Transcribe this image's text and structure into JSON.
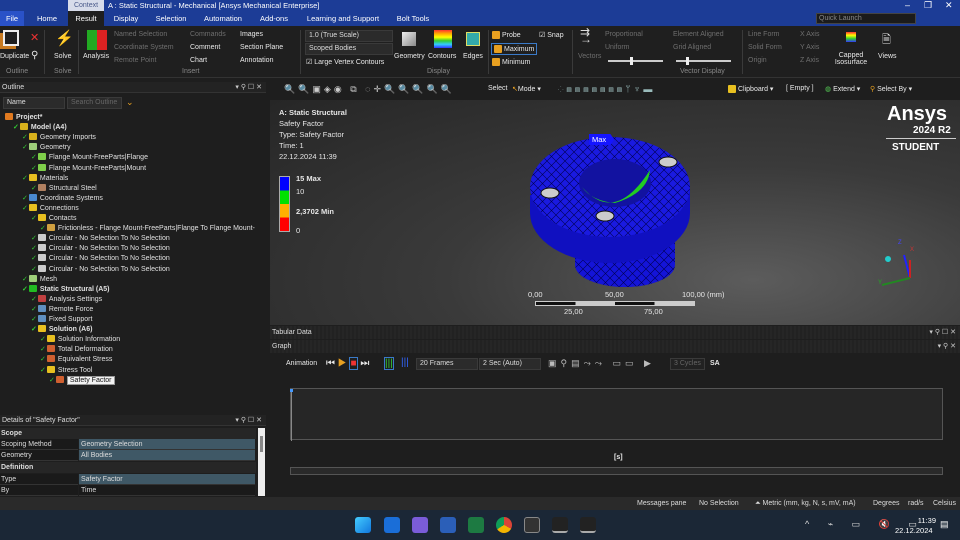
{
  "window": {
    "context_tab": "Context",
    "title": "A : Static Structural - Mechanical [Ansys Mechanical Enterprise]",
    "quick_launch_placeholder": "Quick Launch"
  },
  "menu": [
    "File",
    "Home",
    "Result",
    "Display",
    "Selection",
    "Automation",
    "Add-ons",
    "Learning and Support",
    "Bolt Tools"
  ],
  "ribbon": {
    "duplicate": "Duplicate",
    "outline_group": "Outline",
    "solve": "Solve",
    "solve_group": "Solve",
    "analysis": "Analysis",
    "named_selection": "Named Selection",
    "coordinate_system": "Coordinate System",
    "remote_point": "Remote Point",
    "commands": "Commands",
    "comment": "Comment",
    "chart": "Chart",
    "images": "Images",
    "section_plane": "Section Plane",
    "annotation": "Annotation",
    "insert_group": "Insert",
    "scale": "1.0 (True Scale)",
    "scope": "Scoped Bodies",
    "large_vertex": "Large Vertex Contours",
    "geometry": "Geometry",
    "contours": "Contours",
    "edges": "Edges",
    "display_group": "Display",
    "probe": "Probe",
    "maximum": "Maximum",
    "minimum": "Minimum",
    "snap": "Snap",
    "vectors": "Vectors",
    "proportional": "Proportional",
    "uniform": "Uniform",
    "element_aligned": "Element Aligned",
    "grid_aligned": "Grid Aligned",
    "vector_display_group": "Vector Display",
    "line_form": "Line Form",
    "solid_form": "Solid Form",
    "origin": "Origin",
    "x_axis": "X Axis",
    "y_axis": "Y Axis",
    "z_axis": "Z Axis",
    "capped_isosurface": "Capped Isosurface",
    "views": "Views"
  },
  "viewtoolbar": {
    "select": "Select",
    "mode": "Mode",
    "clipboard": "Clipboard",
    "empty": "[ Empty ]",
    "extend": "Extend",
    "select_by": "Select By"
  },
  "outline": {
    "title": "Outline",
    "filter": "Name",
    "search_placeholder": "Search Outline",
    "items": [
      {
        "label": "Project*",
        "level": 0,
        "bold": true,
        "color": "#e07a20"
      },
      {
        "label": "Model (A4)",
        "level": 1,
        "bold": true,
        "color": "#d9b21c"
      },
      {
        "label": "Geometry Imports",
        "level": 2,
        "color": "#d9b21c"
      },
      {
        "label": "Geometry",
        "level": 2,
        "color": "#9fcf7a"
      },
      {
        "label": "Flange Mount-FreeParts|Flange",
        "level": 3,
        "color": "#7fcf4a"
      },
      {
        "label": "Flange Mount-FreeParts|Mount",
        "level": 3,
        "color": "#7fcf4a"
      },
      {
        "label": "Materials",
        "level": 2,
        "color": "#e8c020"
      },
      {
        "label": "Structural Steel",
        "level": 3,
        "color": "#b08060"
      },
      {
        "label": "Coordinate Systems",
        "level": 2,
        "color": "#4a8ad0"
      },
      {
        "label": "Connections",
        "level": 2,
        "color": "#e8c020"
      },
      {
        "label": "Contacts",
        "level": 3,
        "color": "#e8c020"
      },
      {
        "label": "Frictionless - Flange Mount-FreeParts|Flange To Flange Mount-",
        "level": 4,
        "color": "#d0a040"
      },
      {
        "label": "Circular - No Selection To No Selection",
        "level": 3,
        "color": "#cccccc"
      },
      {
        "label": "Circular - No Selection To No Selection",
        "level": 3,
        "color": "#cccccc"
      },
      {
        "label": "Circular - No Selection To No Selection",
        "level": 3,
        "color": "#cccccc"
      },
      {
        "label": "Circular - No Selection To No Selection",
        "level": 3,
        "color": "#cccccc"
      },
      {
        "label": "Mesh",
        "level": 2,
        "color": "#9fcf7a"
      },
      {
        "label": "Static Structural (A5)",
        "level": 2,
        "bold": true,
        "color": "#22bb22"
      },
      {
        "label": "Analysis Settings",
        "level": 3,
        "color": "#c04040"
      },
      {
        "label": "Remote Force",
        "level": 3,
        "color": "#6090c0"
      },
      {
        "label": "Fixed Support",
        "level": 3,
        "color": "#6090c0"
      },
      {
        "label": "Solution (A6)",
        "level": 3,
        "bold": true,
        "color": "#e8c020"
      },
      {
        "label": "Solution Information",
        "level": 4,
        "color": "#e8c020"
      },
      {
        "label": "Total Deformation",
        "level": 4,
        "color": "#d06030"
      },
      {
        "label": "Equivalent Stress",
        "level": 4,
        "color": "#d06030"
      },
      {
        "label": "Stress Tool",
        "level": 4,
        "color": "#e8c020"
      },
      {
        "label": "Safety Factor",
        "level": 5,
        "color": "#d06030",
        "selected": true
      }
    ]
  },
  "details": {
    "title": "Details of \"Safety Factor\"",
    "scope": "Scope",
    "scoping_method_k": "Scoping Method",
    "scoping_method_v": "Geometry Selection",
    "geometry_k": "Geometry",
    "geometry_v": "All Bodies",
    "definition": "Definition",
    "type_k": "Type",
    "type_v": "Safety Factor",
    "by_k": "By",
    "by_v": "Time"
  },
  "viewport": {
    "title": "A: Static Structural",
    "result": "Safety Factor",
    "type": "Type: Safety Factor",
    "time": "Time: 1",
    "date": "22.12.2024 11:39",
    "legend": {
      "max": "15 Max",
      "v10": "10",
      "min": "2,3702 Min",
      "v0": "0",
      "colors": [
        "#0000ff",
        "#00e000",
        "#ffb000",
        "#ff0000"
      ]
    },
    "max_label": "Max",
    "brand": "Ansys",
    "version": "2024 R2",
    "edition": "STUDENT",
    "scale": {
      "s0": "0,00",
      "s50": "50,00",
      "s100": "100,00 (mm)",
      "s25": "25,00",
      "s75": "75,00"
    },
    "axes": {
      "x": "X",
      "y": "Y",
      "z": "Z"
    }
  },
  "bottom": {
    "tabular": "Tabular Data",
    "graph": "Graph",
    "animation": "Animation",
    "frames": "20 Frames",
    "duration": "2 Sec (Auto)",
    "cycles": "3 Cycles",
    "sa": "SA",
    "xunit": "[s]"
  },
  "status": {
    "messages": "Messages pane",
    "selection": "No Selection",
    "units": "Metric (mm, kg, N, s, mV, mA)",
    "angle": "Degrees",
    "rot": "rad/s",
    "temp": "Celsius"
  },
  "taskbar": {
    "time": "11:39",
    "date": "22.12.2024"
  }
}
